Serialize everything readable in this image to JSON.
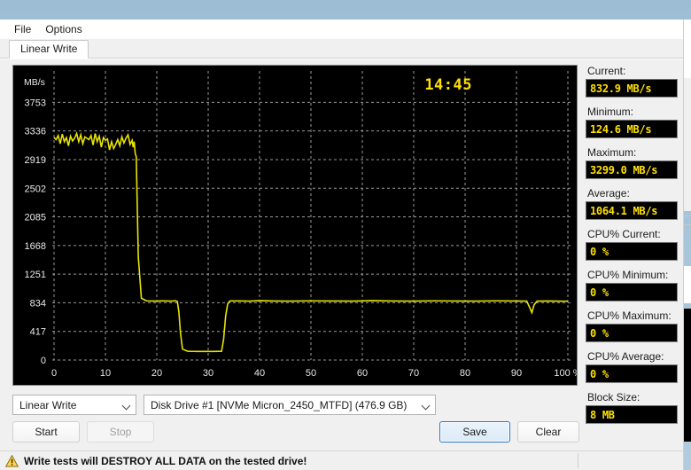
{
  "window": {
    "menu": [
      {
        "label": "File"
      },
      {
        "label": "Options"
      }
    ],
    "tabs": [
      {
        "label": "Linear Write"
      }
    ]
  },
  "graph": {
    "y_axis_unit": "MB/s",
    "timer": "14:45",
    "x_axis_suffix": "%",
    "line_color": "#e8e400",
    "background_color": "#000000"
  },
  "chart_data": {
    "type": "line",
    "title": "Linear Write",
    "xlabel": "%",
    "ylabel": "MB/s",
    "xlim": [
      0,
      100
    ],
    "ylim": [
      0,
      3900
    ],
    "grid": true,
    "legend": "none",
    "xticks": [
      "0",
      "10",
      "20",
      "30",
      "40",
      "50",
      "60",
      "70",
      "80",
      "90",
      "100 %"
    ],
    "xtick_values": [
      0,
      10,
      20,
      30,
      40,
      50,
      60,
      70,
      80,
      90,
      100
    ],
    "yticks": [
      "0",
      "417",
      "834",
      "1251",
      "1668",
      "2085",
      "2502",
      "2919",
      "3336",
      "3753"
    ],
    "ytick_values": [
      0,
      417,
      834,
      1251,
      1668,
      2085,
      2502,
      2919,
      3336,
      3753
    ],
    "annotations": [
      {
        "text": "14:45",
        "x": 72,
        "y": 3780
      }
    ],
    "series": [
      {
        "name": "Linear Write",
        "color": "#e8e400",
        "x": [
          0.0,
          0.4,
          0.8,
          1.2,
          1.6,
          2.0,
          2.4,
          2.8,
          3.2,
          3.6,
          4.0,
          4.4,
          4.8,
          5.2,
          5.6,
          6.0,
          6.4,
          6.8,
          7.2,
          7.6,
          8.0,
          8.4,
          8.8,
          9.2,
          9.6,
          10.0,
          10.4,
          10.8,
          11.2,
          11.6,
          12.0,
          12.4,
          12.8,
          13.2,
          13.6,
          14.0,
          14.4,
          14.8,
          15.2,
          15.4,
          15.6,
          15.8,
          16.0,
          16.4,
          17.0,
          18.0,
          19.0,
          20.0,
          21.0,
          22.0,
          23.0,
          23.6,
          24.0,
          24.3,
          24.6,
          25.0,
          26.0,
          27.0,
          28.0,
          29.0,
          30.0,
          31.0,
          32.0,
          32.6,
          33.0,
          33.4,
          33.8,
          34.2,
          34.6,
          35.0,
          36.0,
          38.0,
          40.0,
          43.0,
          46.0,
          50.0,
          54.0,
          58.0,
          62.0,
          66.0,
          70.0,
          74.0,
          78.0,
          82.0,
          86.0,
          90.0,
          92.0,
          92.6,
          93.0,
          93.4,
          94.0,
          96.0,
          98.0,
          100.0
        ],
        "y": [
          3240,
          3210,
          3270,
          3150,
          3290,
          3180,
          3240,
          3120,
          3260,
          3190,
          3230,
          3300,
          3180,
          3280,
          3150,
          3250,
          3230,
          3210,
          3270,
          3130,
          3299,
          3180,
          3260,
          3100,
          3240,
          3200,
          3220,
          3060,
          3180,
          3080,
          3140,
          3210,
          3120,
          3250,
          3160,
          3230,
          3280,
          3140,
          3200,
          3100,
          3180,
          3010,
          2960,
          1500,
          900,
          862,
          860,
          858,
          862,
          860,
          858,
          865,
          852,
          700,
          400,
          160,
          128,
          126,
          125,
          124.6,
          126,
          125,
          127,
          126,
          300,
          640,
          820,
          858,
          862,
          860,
          862,
          858,
          864,
          860,
          858,
          862,
          860,
          858,
          864,
          860,
          858,
          862,
          860,
          858,
          862,
          860,
          858,
          760,
          690,
          800,
          858,
          860,
          858,
          856
        ]
      }
    ]
  },
  "toolbar": {
    "test_mode": "Linear Write",
    "drive": "Disk Drive #1  [NVMe   Micron_2450_MTFD]  (476.9 GB)",
    "start_label": "Start",
    "stop_label": "Stop",
    "save_label": "Save",
    "clear_label": "Clear"
  },
  "warning": {
    "icon": "warning-triangle-icon",
    "text": "Write tests will DESTROY ALL DATA on the tested drive!"
  },
  "stats": [
    {
      "label": "Current:",
      "value": "832.9 MB/s",
      "spaced": false
    },
    {
      "label": "Minimum:",
      "value": "124.6 MB/s",
      "spaced": false
    },
    {
      "label": "Maximum:",
      "value": "3299.0 MB/s",
      "spaced": false
    },
    {
      "label": "Average:",
      "value": "1064.1 MB/s",
      "spaced": false
    },
    {
      "label": "CPU% Current:",
      "value": "0 %",
      "spaced": true
    },
    {
      "label": "CPU% Minimum:",
      "value": "0 %",
      "spaced": false
    },
    {
      "label": "CPU% Maximum:",
      "value": "0 %",
      "spaced": false
    },
    {
      "label": "CPU% Average:",
      "value": "0 %",
      "spaced": false
    },
    {
      "label": "Block Size:",
      "value": "8 MB",
      "spaced": false
    }
  ],
  "colors": {
    "desktop": "#a9c6da",
    "accent_yellow": "#ffe000",
    "plot_yellow": "#e8e400",
    "default_button_border": "#2b77c4"
  }
}
